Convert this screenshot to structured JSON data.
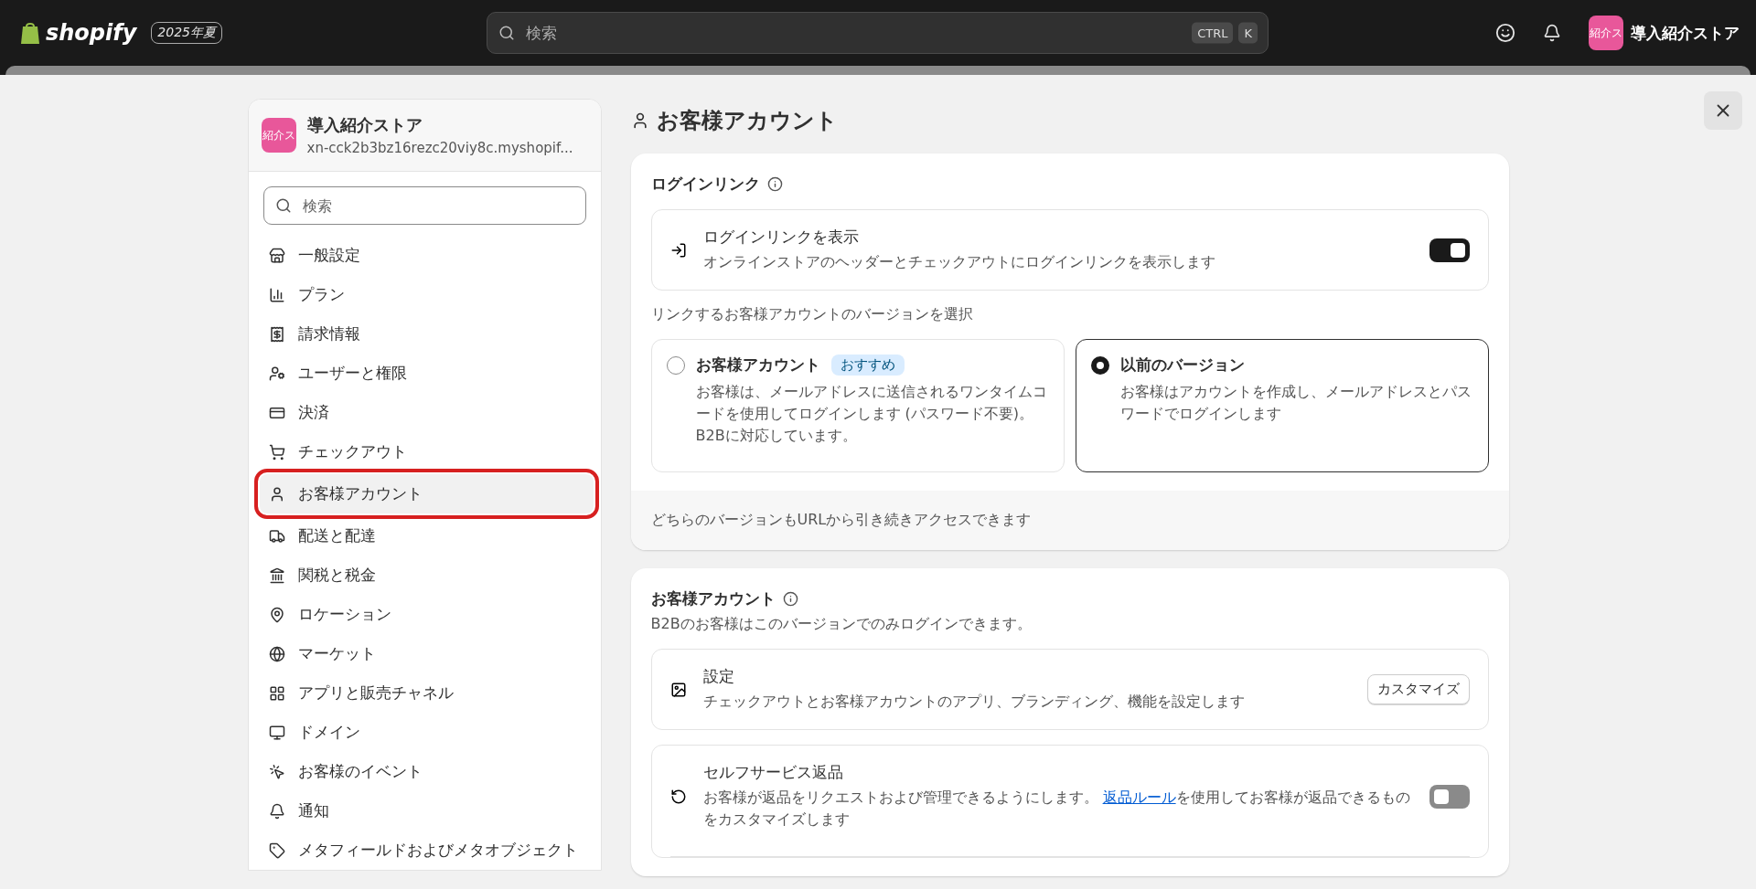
{
  "topbar": {
    "logo_text": "shopify",
    "edition_badge": "2025年夏",
    "search": {
      "placeholder": "検索",
      "shortcut_keys": [
        "CTRL",
        "K"
      ]
    },
    "store": {
      "avatar_text": "紹介ス",
      "name": "導入紹介ストア"
    }
  },
  "sidebar": {
    "store": {
      "avatar_text": "紹介ス",
      "name": "導入紹介ストア",
      "domain": "xn-cck2b3bz16rezc20viy8c.myshopif..."
    },
    "search": {
      "placeholder": "検索"
    },
    "items": [
      {
        "label": "一般設定",
        "selected": false,
        "highlighted": false
      },
      {
        "label": "プラン",
        "selected": false,
        "highlighted": false
      },
      {
        "label": "請求情報",
        "selected": false,
        "highlighted": false
      },
      {
        "label": "ユーザーと権限",
        "selected": false,
        "highlighted": false
      },
      {
        "label": "決済",
        "selected": false,
        "highlighted": false
      },
      {
        "label": "チェックアウト",
        "selected": false,
        "highlighted": false
      },
      {
        "label": "お客様アカウント",
        "selected": true,
        "highlighted": true
      },
      {
        "label": "配送と配達",
        "selected": false,
        "highlighted": false
      },
      {
        "label": "関税と税金",
        "selected": false,
        "highlighted": false
      },
      {
        "label": "ロケーション",
        "selected": false,
        "highlighted": false
      },
      {
        "label": "マーケット",
        "selected": false,
        "highlighted": false
      },
      {
        "label": "アプリと販売チャネル",
        "selected": false,
        "highlighted": false
      },
      {
        "label": "ドメイン",
        "selected": false,
        "highlighted": false
      },
      {
        "label": "お客様のイベント",
        "selected": false,
        "highlighted": false
      },
      {
        "label": "通知",
        "selected": false,
        "highlighted": false
      },
      {
        "label": "メタフィールドおよびメタオブジェクト",
        "selected": false,
        "highlighted": false
      }
    ]
  },
  "main": {
    "title": "お客様アカウント",
    "login_card": {
      "title": "ログインリンク",
      "setting": {
        "title": "ログインリンクを表示",
        "description": "オンラインストアのヘッダーとチェックアウトにログインリンクを表示します",
        "on": true
      },
      "version_prompt": "リンクするお客様アカウントのバージョンを選択",
      "options": [
        {
          "title": "お客様アカウント",
          "badge": "おすすめ",
          "description": "お客様は、メールアドレスに送信されるワンタイムコードを使用してログインします (パスワード不要)。B2Bに対応しています。",
          "selected": false
        },
        {
          "title": "以前のバージョン",
          "description": "お客様はアカウントを作成し、メールアドレスとパスワードでログインします",
          "selected": true
        }
      ],
      "footer": "どちらのバージョンもURLから引き続きアクセスできます"
    },
    "accounts_card": {
      "title": "お客様アカウント",
      "subtitle": "B2Bのお客様はこのバージョンでのみログインできます。",
      "rows": [
        {
          "kind": "button",
          "title": "設定",
          "description": "チェックアウトとお客様アカウントのアプリ、ブランディング、機能を設定します",
          "button": "カスタマイズ"
        },
        {
          "kind": "toggle",
          "title": "セルフサービス返品",
          "description_before": "お客様が返品をリクエストおよび管理できるようにします。 ",
          "link": "返品ルール",
          "description_after": "を使用してお客様が返品できるものをカスタマイズします",
          "on": false
        }
      ]
    }
  }
}
